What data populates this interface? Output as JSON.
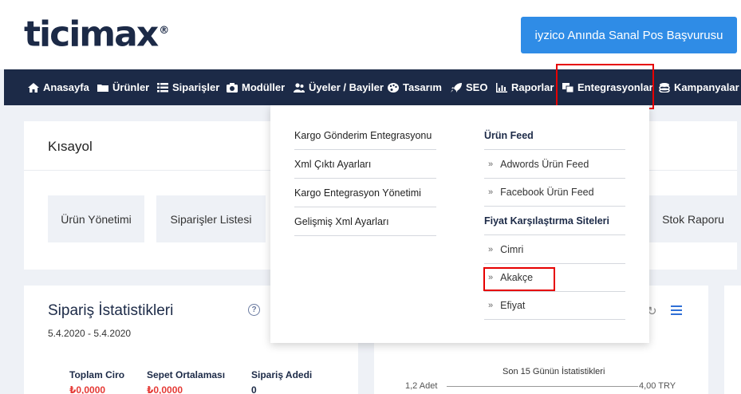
{
  "header": {
    "logo_text": "ticimax",
    "logo_reg": "®",
    "cta_button": "iyzico Anında Sanal Pos Başvurusu"
  },
  "nav": {
    "items": [
      {
        "label": "Anasayfa",
        "icon": "home-icon"
      },
      {
        "label": "Ürünler",
        "icon": "folder-icon"
      },
      {
        "label": "Siparişler",
        "icon": "list-icon"
      },
      {
        "label": "Modüller",
        "icon": "camera-icon"
      },
      {
        "label": "Üyeler / Bayiler",
        "icon": "users-icon"
      },
      {
        "label": "Tasarım",
        "icon": "palette-icon"
      },
      {
        "label": "SEO",
        "icon": "rocket-icon"
      },
      {
        "label": "Raporlar",
        "icon": "chart-icon"
      },
      {
        "label": "Entegrasyonlar",
        "icon": "integration-icon"
      },
      {
        "label": "Kampanyalar",
        "icon": "coins-icon"
      }
    ],
    "active": "Entegrasyonlar"
  },
  "kisayol": {
    "title": "Kısayol",
    "shortcuts": [
      "Ürün Yönetimi",
      "Siparişler Listesi",
      "Stok Raporu"
    ]
  },
  "stats": {
    "title": "Sipariş İstatistikleri",
    "date_range": "5.4.2020 - 5.4.2020",
    "columns": [
      "Toplam Ciro",
      "Sepet Ortalaması",
      "Sipariş Adedi"
    ],
    "values": [
      "₺0,0000",
      "₺0,0000",
      "0"
    ],
    "chart_caption": "Son 15 Günün İstatistikleri",
    "chart_left_label": "1,2 Adet",
    "chart_right_label": "4,00 TRY"
  },
  "dropdown": {
    "left_items": [
      "Kargo Gönderim Entegrasyonu",
      "Xml Çıktı Ayarları",
      "Kargo Entegrasyon Yönetimi",
      "Gelişmiş Xml Ayarları"
    ],
    "right": {
      "group1_title": "Ürün Feed",
      "group1_items": [
        "Adwords Ürün Feed",
        "Facebook Ürün Feed"
      ],
      "group2_title": "Fiyat Karşılaştırma Siteleri",
      "group2_items": [
        "Cimri",
        "Akakçe",
        "Efiyat"
      ]
    },
    "chevron": "»"
  },
  "colors": {
    "nav_bg": "#1c2a47",
    "cta_bg": "#2f8ce6",
    "highlight": "#e60000"
  }
}
